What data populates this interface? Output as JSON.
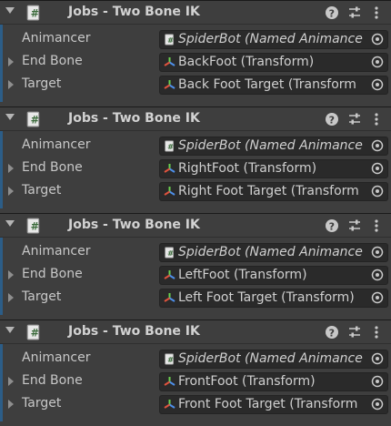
{
  "components": [
    {
      "title": "Jobs - Two Bone IK",
      "rows": [
        {
          "label": "Animancer",
          "value": "SpiderBot (Named Animance",
          "italic": true,
          "icon": "script-icon"
        },
        {
          "label": "End Bone",
          "value": "BackFoot (Transform)",
          "italic": false,
          "icon": "transform-icon"
        },
        {
          "label": "Target",
          "value": "Back Foot Target (Transform",
          "italic": false,
          "icon": "transform-icon"
        }
      ]
    },
    {
      "title": "Jobs - Two Bone IK",
      "rows": [
        {
          "label": "Animancer",
          "value": "SpiderBot (Named Animance",
          "italic": true,
          "icon": "script-icon"
        },
        {
          "label": "End Bone",
          "value": "RightFoot (Transform)",
          "italic": false,
          "icon": "transform-icon"
        },
        {
          "label": "Target",
          "value": "Right Foot Target (Transform",
          "italic": false,
          "icon": "transform-icon"
        }
      ]
    },
    {
      "title": "Jobs - Two Bone IK",
      "rows": [
        {
          "label": "Animancer",
          "value": "SpiderBot (Named Animance",
          "italic": true,
          "icon": "script-icon"
        },
        {
          "label": "End Bone",
          "value": "LeftFoot (Transform)",
          "italic": false,
          "icon": "transform-icon"
        },
        {
          "label": "Target",
          "value": "Left Foot Target (Transform)",
          "italic": false,
          "icon": "transform-icon"
        }
      ]
    },
    {
      "title": "Jobs - Two Bone IK",
      "rows": [
        {
          "label": "Animancer",
          "value": "SpiderBot (Named Animance",
          "italic": true,
          "icon": "script-icon"
        },
        {
          "label": "End Bone",
          "value": "FrontFoot (Transform)",
          "italic": false,
          "icon": "transform-icon"
        },
        {
          "label": "Target",
          "value": "Front Foot Target (Transform",
          "italic": false,
          "icon": "transform-icon"
        }
      ]
    }
  ],
  "colors": {
    "accent": "#2c5d87",
    "panel": "#3e3e3e",
    "field": "#2a2a2a"
  }
}
